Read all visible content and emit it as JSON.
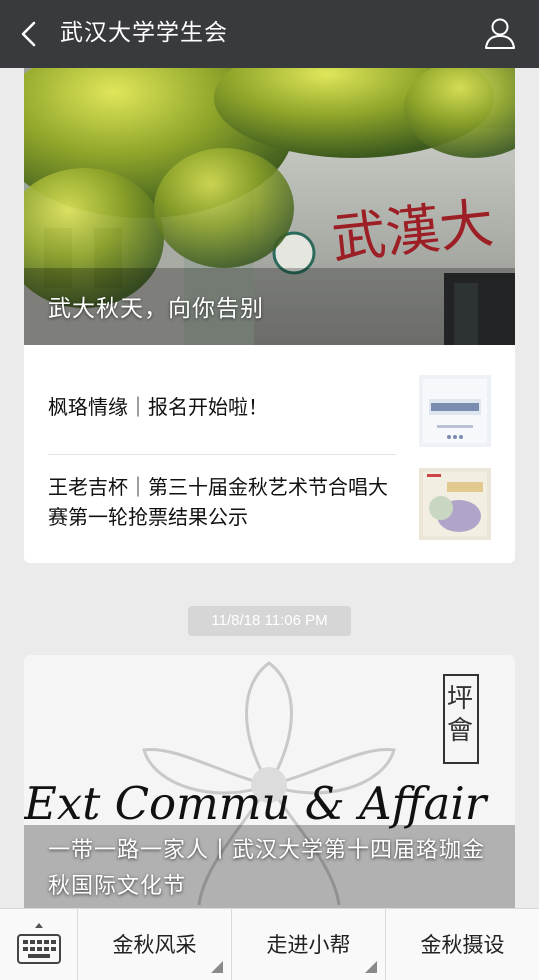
{
  "header": {
    "back_icon": "chevron-left-icon",
    "title": "武汉大学学生会",
    "profile_icon": "person-icon"
  },
  "feed": {
    "card1": {
      "hero_title": "武大秋天，向你告别",
      "items": [
        {
          "title": "枫珞情缘｜报名开始啦！"
        },
        {
          "title": "王老吉杯｜第三十届金秋艺术节合唱大赛第一轮抢票结果公示"
        }
      ]
    },
    "timestamp": "11/8/18 11:06 PM",
    "card2": {
      "banner_text": "Ext Commu & Affair",
      "hero_title": "一带一路一家人丨武汉大学第十四届珞珈金秋国际文化节"
    }
  },
  "menu": {
    "keyboard_icon": "keyboard-icon",
    "tabs": [
      {
        "label": "金秋风采"
      },
      {
        "label": "走进小帮"
      },
      {
        "label": "金秋摄设"
      }
    ]
  },
  "colors": {
    "topbar": "#393a3e",
    "background": "#ebebeb",
    "menu_bg": "#f9f9f9"
  }
}
